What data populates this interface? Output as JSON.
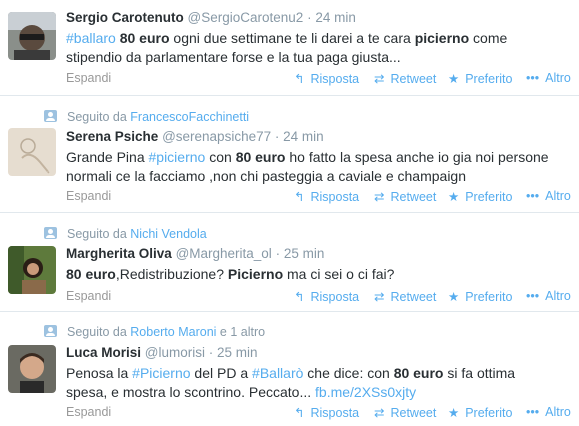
{
  "tweets": [
    {
      "context": null,
      "name": "Sergio Carotenuto",
      "handle": "@SergioCarotenu2",
      "time": "24 min",
      "line1": {
        "tag": "#ballaro",
        "b1": "80 euro",
        "t1": " ogni due settimane te li darei a te cara ",
        "b2": "picierno",
        "t2": " come"
      },
      "line2": "stipendio da parlamentare forse e la tua paga giusta..."
    },
    {
      "context": {
        "prefix": "Seguito da",
        "user": "FrancescoFacchinetti",
        "suffix": ""
      },
      "name": "Serena Psiche",
      "handle": "@serenapsiche77",
      "time": "24 min",
      "line1": {
        "t0": "Grande Pina ",
        "tag": "#picierno",
        "t1": " con ",
        "b1": "80 euro",
        "t2": " ho fatto la spesa anche io gia noi persone"
      },
      "line2": "normali ce la facciamo ,non chi pasteggia a caviale e champaign"
    },
    {
      "context": {
        "prefix": "Seguito da",
        "user": "Nichi Vendola",
        "suffix": ""
      },
      "name": "Margherita Oliva",
      "handle": "@Margherita_ol",
      "time": "25 min",
      "line1": {
        "b1": "80 euro",
        "t1": ",Redistribuzione? ",
        "b2": "Picierno",
        "t2": " ma ci sei o ci fai?"
      }
    },
    {
      "context": {
        "prefix": "Seguito da",
        "user": "Roberto Maroni",
        "suffix": "e 1 altro"
      },
      "name": "Luca Morisi",
      "handle": "@lumorisi",
      "time": "25 min",
      "line1": {
        "t0": "Penosa la ",
        "tag": "#Picierno",
        "t1": " del PD a ",
        "tag2": "#Ballarò",
        "t2": " che dice: con ",
        "b1": "80 euro",
        "t3": " si fa ottima"
      },
      "line2": {
        "t0": "spesa, e mostra lo scontrino. Peccato... ",
        "link": "fb.me/2XSs0xjty"
      }
    }
  ],
  "actions": {
    "expand": "Espandi",
    "reply": "Risposta",
    "retweet": "Retweet",
    "favorite": "Preferito",
    "more": "Altro"
  },
  "colors": {
    "link": "#55acee",
    "meta": "#8899a6",
    "text": "#292f33",
    "divider": "#e1e8ed"
  }
}
